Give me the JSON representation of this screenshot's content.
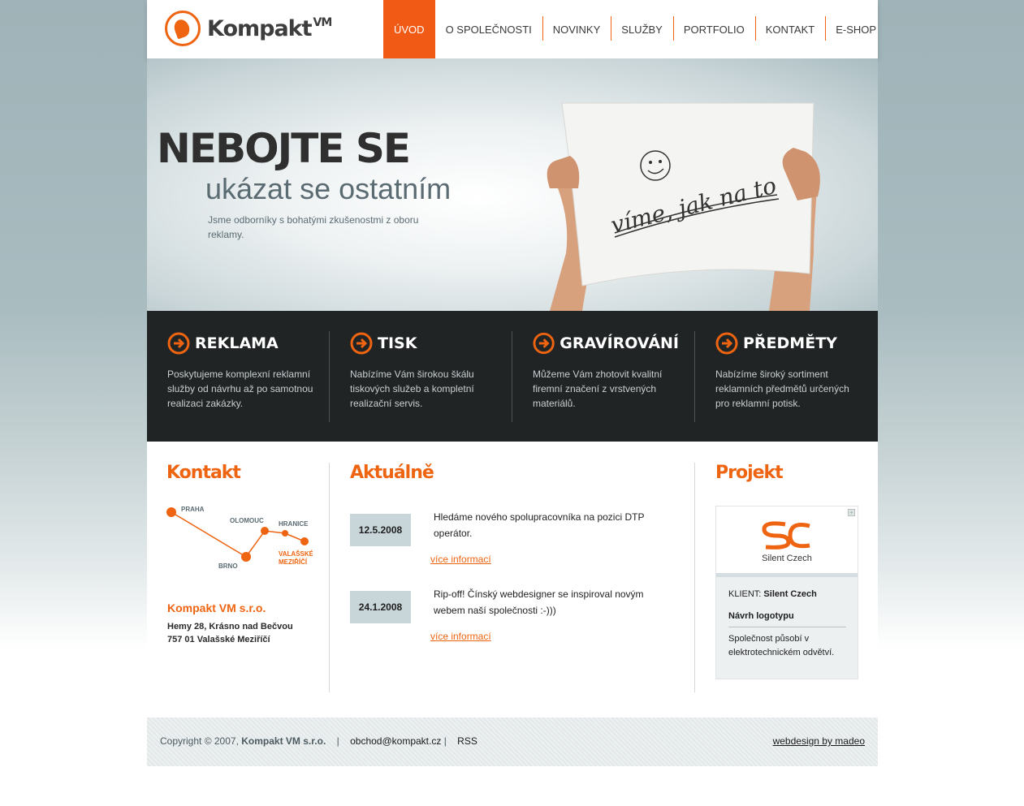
{
  "brand": {
    "name": "Kompakt",
    "suffix": "VM"
  },
  "nav": [
    {
      "label": "ÚVOD",
      "active": true
    },
    {
      "label": "O SPOLEČNOSTI"
    },
    {
      "label": "NOVINKY"
    },
    {
      "label": "SLUŽBY"
    },
    {
      "label": "PORTFOLIO"
    },
    {
      "label": "KONTAKT"
    },
    {
      "label": "E-SHOP"
    }
  ],
  "hero": {
    "title": "NEBOJTE SE",
    "subtitle": "ukázat se ostatním",
    "text": "Jsme odborníky s bohatými zkušenostmi z oboru reklamy.",
    "sign_text": "víme, jak na to"
  },
  "services": [
    {
      "title": "REKLAMA",
      "text": "Poskytujeme komplexní reklamní služby od návrhu až po samotnou realizaci zakázky."
    },
    {
      "title": "TISK",
      "text": "Nabízíme Vám širokou škálu tiskových služeb a kompletní realizační servis."
    },
    {
      "title": "GRAVÍROVÁNÍ",
      "text": "Můžeme Vám zhotovit kvalitní firemní značení z vrstvených materiálů."
    },
    {
      "title": "PŘEDMĚTY",
      "text": "Nabízíme široký sortiment reklamních předmětů určených pro reklamní potisk."
    }
  ],
  "contact": {
    "title": "Kontakt",
    "map_labels": {
      "praha": "PRAHA",
      "olomouc": "OLOMOUC",
      "hranice": "HRANICE",
      "brno": "BRNO",
      "valmez1": "VALAŠSKÉ",
      "valmez2": "MEZIŘÍČÍ"
    },
    "company": "Kompakt VM s.r.o.",
    "address1": "Hemy 28, Krásno nad Bečvou",
    "address2": "757 01 Valašské Meziříčí"
  },
  "news": {
    "title": "Aktuálně",
    "items": [
      {
        "date": "12.5.2008",
        "text": "Hledáme nového spolupracovníka na pozici DTP operátor.",
        "link": "více informací"
      },
      {
        "date": "24.1.2008",
        "text": "Rip-off! Čínský webdesigner se inspiroval novým webem naší společnosti :-)))",
        "link": "více informací"
      }
    ]
  },
  "project": {
    "title": "Projekt",
    "logo_name": "Silent Czech",
    "client_label": "KLIENT:",
    "client": "Silent Czech",
    "subtitle": "Návrh logotypu",
    "desc": "Společnost působí v elektrotechnickém odvětví.",
    "plus_icon": "⊞"
  },
  "footer": {
    "copyright": "Copyright © 2007,",
    "company": "Kompakt VM s.r.o.",
    "sep1": "|",
    "email": "obchod@kompakt.cz",
    "sep2": "|",
    "rss": "RSS",
    "credit": "webdesign by madeo"
  },
  "colors": {
    "accent": "#ee6411",
    "dark": "#202425",
    "date_bg": "#c8d5d9"
  }
}
